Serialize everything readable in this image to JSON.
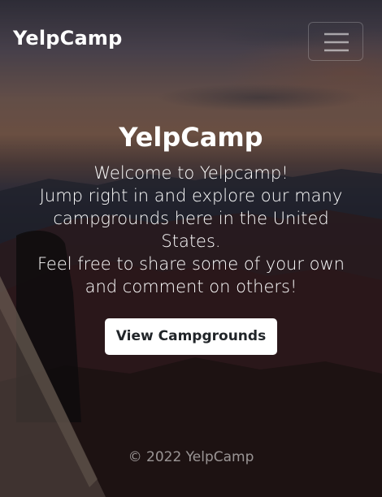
{
  "navbar": {
    "brand": "YelpCamp",
    "menu_icon": "hamburger-menu-icon"
  },
  "hero": {
    "title": "YelpCamp",
    "lines": [
      "Welcome to Yelpcamp!",
      "Jump right in and explore our many campgrounds here in the United States.",
      "Feel free to share some of your own and comment on others!"
    ],
    "button_label": "View Campgrounds"
  },
  "footer": {
    "text": "© 2022 YelpCamp"
  },
  "colors": {
    "button_bg": "#ffffff",
    "button_text": "#212529",
    "footer_text": "rgba(255,255,255,0.55)"
  }
}
